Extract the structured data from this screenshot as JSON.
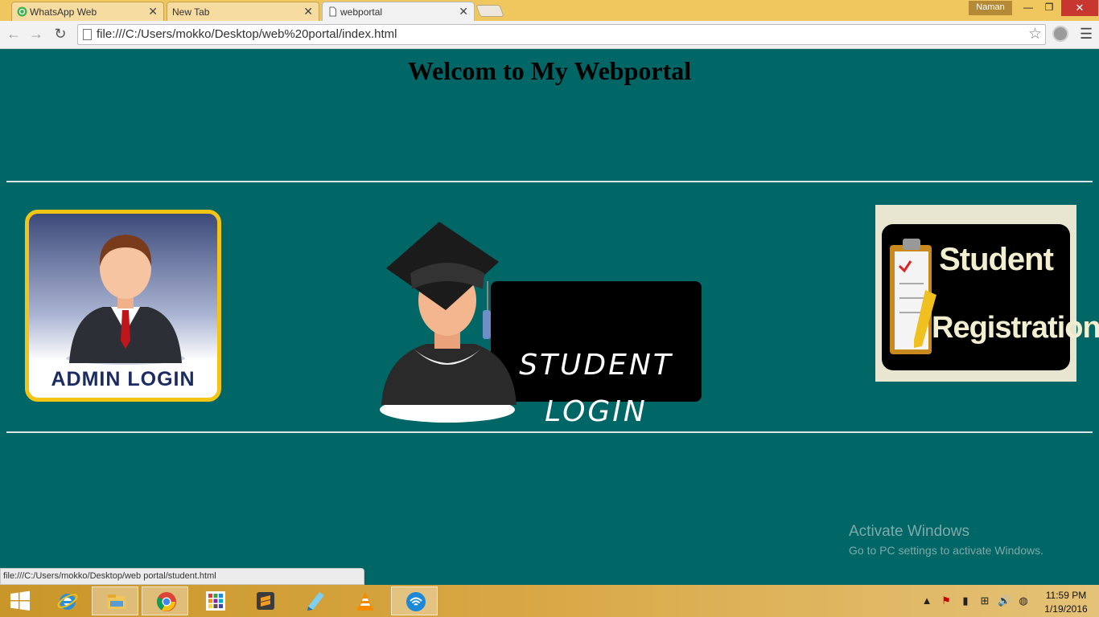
{
  "browser": {
    "tabs": [
      {
        "label": "WhatsApp Web",
        "icon": "whatsapp-icon",
        "active": false
      },
      {
        "label": "New Tab",
        "icon": "none",
        "active": false
      },
      {
        "label": "webportal",
        "icon": "page-icon",
        "active": true
      }
    ],
    "profile_name": "Naman",
    "url": "file:///C:/Users/mokko/Desktop/web%20portal/index.html"
  },
  "page": {
    "title": "Welcom to My Webportal",
    "admin_login_label": "ADMIN LOGIN",
    "student_login_line1": "STUDENT",
    "student_login_line2": "LOGIN",
    "registration_line1": "Student",
    "registration_line2": "Registration",
    "background_color": "#006766"
  },
  "watermark": {
    "title": "Activate Windows",
    "subtitle": "Go to PC settings to activate Windows."
  },
  "status_bar": {
    "text": "file:///C:/Users/mokko/Desktop/web portal/student.html"
  },
  "taskbar": {
    "apps": [
      "windows-start",
      "internet-explorer",
      "file-explorer",
      "chrome",
      "app-grid",
      "sublime-text",
      "notepad",
      "vlc",
      "wifi-hotspot"
    ],
    "time": "11:59 PM",
    "date": "1/19/2016"
  }
}
